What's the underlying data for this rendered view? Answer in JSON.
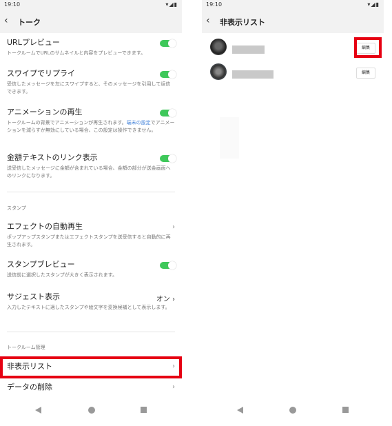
{
  "left": {
    "status_time": "19:10",
    "title": "トーク",
    "settings": [
      {
        "label": "URLプレビュー",
        "desc": "トークルームでURLのサムネイルと内容をプレビューできます。"
      },
      {
        "label": "スワイプでリプライ",
        "desc": "受信したメッセージを左にスワイプすると、そのメッセージを引用して返信できます。"
      },
      {
        "label": "アニメーションの再生",
        "desc_before": "トークルームの背景でアニメーションが再生されます。",
        "desc_link": "端末の設定",
        "desc_after": "でアニメーションを減らすか無効にしている場合、この設定は操作できません。"
      },
      {
        "label": "金額テキストのリンク表示",
        "desc": "送受信したメッセージに金額が含まれている場合、金額の部分が送金画面へのリンクになります。"
      }
    ],
    "section_stamp": "スタンプ",
    "stamp_effect": {
      "label": "エフェクトの自動再生",
      "desc": "ポップアップスタンプまたはエフェクトスタンプを送受信すると自動的に再生されます。"
    },
    "stamp_preview": {
      "label": "スタンプブレビュー",
      "desc": "送信前に選択したスタンプが大きく表示されます。"
    },
    "suggest": {
      "label": "サジェスト表示",
      "value": "オン",
      "desc": "入力したテキストに適したスタンプや絵文字を変換候補として表示します。"
    },
    "section_room": "トークルーム管理",
    "hidden_list": "非表示リスト",
    "delete_data": "データの削除"
  },
  "right": {
    "status_time": "19:10",
    "title": "非表示リスト",
    "edit_label": "編集"
  },
  "colors": {
    "toggle_on": "#3ec85a",
    "highlight": "#e60012",
    "link": "#3b7dd8"
  }
}
